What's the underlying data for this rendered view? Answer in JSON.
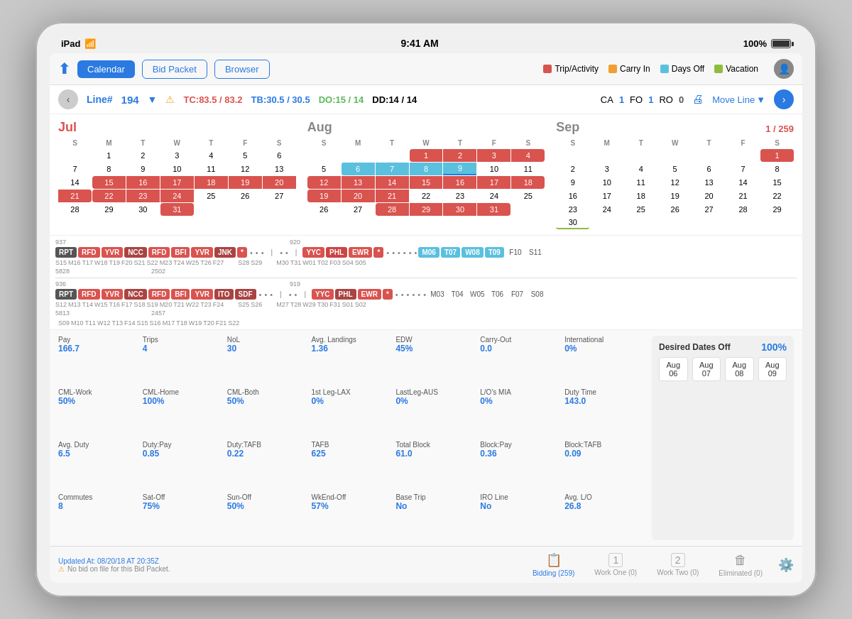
{
  "statusBar": {
    "device": "iPad",
    "time": "9:41 AM",
    "battery": "100%"
  },
  "nav": {
    "tabs": [
      "Calendar",
      "Bid Packet",
      "Browser"
    ],
    "activeTab": "Calendar",
    "legend": {
      "tripActivity": "Trip/Activity",
      "carryIn": "Carry In",
      "daysOff": "Days Off",
      "vacation": "Vacation"
    }
  },
  "lineBar": {
    "lineNumber": "194",
    "tc": "TC:83.5 / 83.2",
    "tb": "TB:30.5 / 30.5",
    "do": "DO:15 / 14",
    "dd": "DD:14 / 14",
    "ca": "CA 1",
    "fo": "FO 1",
    "ro": "RO 0",
    "moveLine": "Move Line"
  },
  "months": {
    "jul": {
      "name": "Jul",
      "dows": [
        "S",
        "M",
        "T",
        "W",
        "T",
        "F",
        "S"
      ],
      "weeks": [
        [
          "",
          "1",
          "2",
          "3",
          "4",
          "5",
          "6",
          "7"
        ],
        [
          "",
          "8",
          "9",
          "10",
          "11",
          "12",
          "13",
          "14"
        ],
        [
          "",
          "15",
          "16",
          "17",
          "18",
          "19",
          "20",
          "21"
        ],
        [
          "",
          "22",
          "23",
          "24",
          "25",
          "26",
          "27",
          "28"
        ],
        [
          "",
          "29",
          "30",
          "31",
          "",
          "",
          "",
          ""
        ]
      ]
    },
    "aug": {
      "name": "Aug",
      "dows": [
        "S",
        "M",
        "T",
        "W",
        "T",
        "F",
        "S"
      ]
    },
    "sep": {
      "name": "Sep",
      "dows": [
        "S",
        "M",
        "T",
        "W",
        "T",
        "F",
        "S"
      ],
      "pageIndicator": "1 / 259"
    }
  },
  "stats": [
    {
      "label": "Pay",
      "value": "166.7"
    },
    {
      "label": "Trips",
      "value": "4"
    },
    {
      "label": "NoL",
      "value": "30"
    },
    {
      "label": "Avg. Landings",
      "value": "1.36"
    },
    {
      "label": "EDW",
      "value": "45%"
    },
    {
      "label": "Carry-Out",
      "value": "0.0"
    },
    {
      "label": "International",
      "value": "0%"
    },
    {
      "label": "CML-Work",
      "value": "50%"
    },
    {
      "label": "CML-Home",
      "value": "100%"
    },
    {
      "label": "CML-Both",
      "value": "50%"
    },
    {
      "label": "1st Leg-LAX",
      "value": "0%"
    },
    {
      "label": "LastLeg-AUS",
      "value": "0%"
    },
    {
      "label": "L/O's MIA",
      "value": "0%"
    },
    {
      "label": "Duty Time",
      "value": "143.0"
    },
    {
      "label": "Avg. Duty",
      "value": "6.5"
    },
    {
      "label": "Duty:Pay",
      "value": "0.85"
    },
    {
      "label": "Duty:TAFB",
      "value": "0.22"
    },
    {
      "label": "TAFB",
      "value": "625"
    },
    {
      "label": "Total Block",
      "value": "61.0"
    },
    {
      "label": "Block:Pay",
      "value": "0.36"
    },
    {
      "label": "Block:TAFB",
      "value": "0.09"
    },
    {
      "label": "Commutes",
      "value": "8"
    },
    {
      "label": "Sat-Off",
      "value": "75%"
    },
    {
      "label": "Sun-Off",
      "value": "50%"
    },
    {
      "label": "WkEnd-Off",
      "value": "57%"
    },
    {
      "label": "Base Trip",
      "value": "No"
    },
    {
      "label": "IRO Line",
      "value": "No"
    },
    {
      "label": "Avg. L/O",
      "value": "26.8"
    }
  ],
  "desiredDates": {
    "title": "Desired Dates Off",
    "percentage": "100%",
    "dates": [
      "Aug 06",
      "Aug 07",
      "Aug 08",
      "Aug 09"
    ]
  },
  "bottomBar": {
    "updateText": "Updated At: 08/20/18 AT 20:35Z",
    "warningText": "No bid on file for this Bid Packet.",
    "tabs": [
      {
        "label": "Bidding (259)",
        "icon": "📋",
        "active": true
      },
      {
        "label": "Work One (0)",
        "icon": "1",
        "active": false
      },
      {
        "label": "Work Two (0)",
        "icon": "2",
        "active": false
      },
      {
        "label": "Eliminated (0)",
        "icon": "🗑",
        "active": false
      }
    ],
    "settingsIcon": "⚙️"
  }
}
